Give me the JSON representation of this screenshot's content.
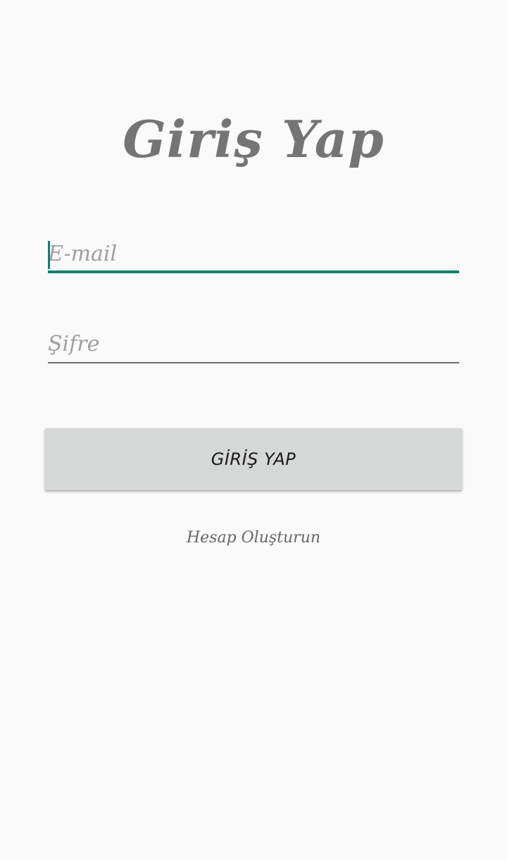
{
  "page": {
    "title": "Giriş Yap"
  },
  "form": {
    "email": {
      "placeholder": "E-mail",
      "value": ""
    },
    "password": {
      "placeholder": "Şifre",
      "value": ""
    },
    "submit_label": "GİRİŞ YAP",
    "create_account_label": "Hesap Oluşturun"
  },
  "colors": {
    "background": "#fafafa",
    "accent": "#0f7f6f",
    "button_bg": "#d6d7d7",
    "title_text": "#757575"
  }
}
